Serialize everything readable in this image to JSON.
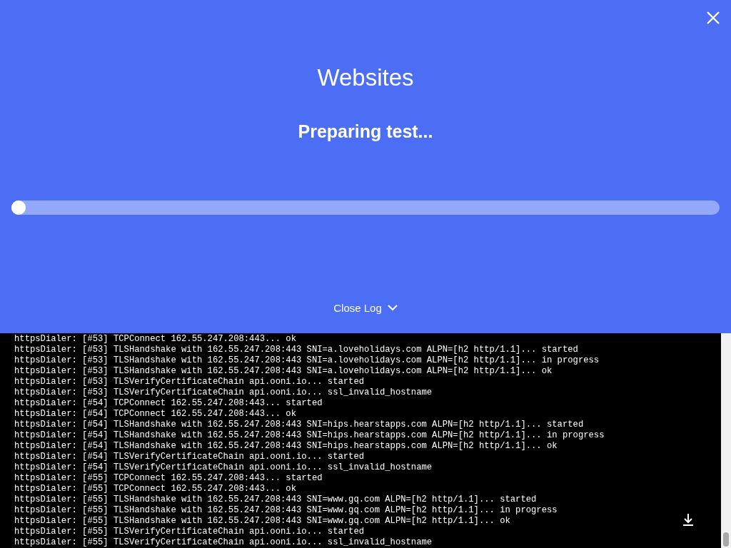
{
  "header": {
    "title": "Websites",
    "status": "Preparing test...",
    "progress": {
      "level": 0
    },
    "log_toggle": {
      "label": "Close Log",
      "expanded": true
    }
  },
  "log": {
    "lines": [
      "httpsDialer: [#53] TCPConnect 162.55.247.208:443... ok",
      "httpsDialer: [#53] TLSHandshake with 162.55.247.208:443 SNI=a.loveholidays.com ALPN=[h2 http/1.1]... started",
      "httpsDialer: [#53] TLSHandshake with 162.55.247.208:443 SNI=a.loveholidays.com ALPN=[h2 http/1.1]... in progress",
      "httpsDialer: [#53] TLSHandshake with 162.55.247.208:443 SNI=a.loveholidays.com ALPN=[h2 http/1.1]... ok",
      "httpsDialer: [#53] TLSVerifyCertificateChain api.ooni.io... started",
      "httpsDialer: [#53] TLSVerifyCertificateChain api.ooni.io... ssl_invalid_hostname",
      "httpsDialer: [#54] TCPConnect 162.55.247.208:443... started",
      "httpsDialer: [#54] TCPConnect 162.55.247.208:443... ok",
      "httpsDialer: [#54] TLSHandshake with 162.55.247.208:443 SNI=hips.hearstapps.com ALPN=[h2 http/1.1]... started",
      "httpsDialer: [#54] TLSHandshake with 162.55.247.208:443 SNI=hips.hearstapps.com ALPN=[h2 http/1.1]... in progress",
      "httpsDialer: [#54] TLSHandshake with 162.55.247.208:443 SNI=hips.hearstapps.com ALPN=[h2 http/1.1]... ok",
      "httpsDialer: [#54] TLSVerifyCertificateChain api.ooni.io... started",
      "httpsDialer: [#54] TLSVerifyCertificateChain api.ooni.io... ssl_invalid_hostname",
      "httpsDialer: [#55] TCPConnect 162.55.247.208:443... started",
      "httpsDialer: [#55] TCPConnect 162.55.247.208:443... ok",
      "httpsDialer: [#55] TLSHandshake with 162.55.247.208:443 SNI=www.gq.com ALPN=[h2 http/1.1]... started",
      "httpsDialer: [#55] TLSHandshake with 162.55.247.208:443 SNI=www.gq.com ALPN=[h2 http/1.1]... in progress",
      "httpsDialer: [#55] TLSHandshake with 162.55.247.208:443 SNI=www.gq.com ALPN=[h2 http/1.1]... ok",
      "httpsDialer: [#55] TLSVerifyCertificateChain api.ooni.io... started",
      "httpsDialer: [#55] TLSVerifyCertificateChain api.ooni.io... ssl_invalid_hostname"
    ]
  }
}
